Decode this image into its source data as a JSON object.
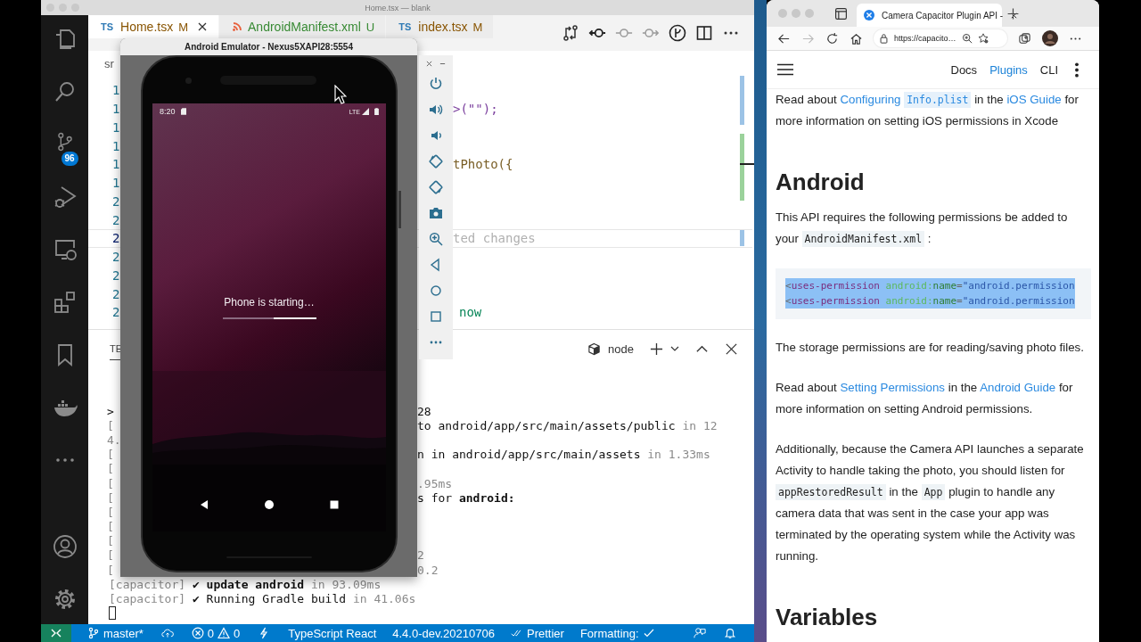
{
  "vscode": {
    "title": "Home.tsx — blank",
    "source_control_badge": "96",
    "tabs": [
      {
        "kind": "ts",
        "badge": "TS",
        "label": "Home.tsx",
        "status": "M",
        "modified": true,
        "selected": true
      },
      {
        "kind": "xml",
        "label": "AndroidManifest.xml",
        "status": "U",
        "modified": false,
        "selected": false
      },
      {
        "kind": "ts",
        "badge": "TS",
        "label": "index.tsx",
        "status": "M",
        "modified": true,
        "selected": false
      }
    ],
    "breadcrumb": "sr",
    "code_lines": [
      {
        "number": "1",
        "current": false
      },
      {
        "number": "1",
        "code": ">(\"\");",
        "kind": "plain",
        "current": false
      },
      {
        "number": "1",
        "current": false
      },
      {
        "number": "1",
        "current": false
      },
      {
        "number": "1",
        "code": "tPhoto({",
        "kind": "call",
        "current": false
      },
      {
        "number": "1",
        "current": false
      },
      {
        "number": "2",
        "current": false
      },
      {
        "number": "2",
        "current": false
      },
      {
        "number": "2",
        "code": "ted changes",
        "kind": "ghost",
        "current": true
      },
      {
        "number": "2",
        "current": false
      },
      {
        "number": "2",
        "current": false
      },
      {
        "number": "2",
        "current": false
      },
      {
        "number": "2",
        "code": "now",
        "kind": "text",
        "current": false
      }
    ],
    "terminal": {
      "tab": "TE",
      "shell": "node",
      "lines": [
        {
          "kind": "split",
          "left": {
            "text": ">",
            "kind": "plain"
          },
          "right": [
            {
              "text": "28",
              "kind": "plain"
            }
          ]
        },
        {
          "kind": "split",
          "left": {
            "text": "[",
            "kind": "dim"
          },
          "right": [
            {
              "text": "to android/app/src/main/assets/public",
              "kind": "plain"
            },
            {
              "text": "in 12",
              "kind": "dim"
            }
          ]
        },
        {
          "kind": "split",
          "left": {
            "text": "4.",
            "kind": "dim"
          }
        },
        {
          "kind": "split",
          "left": {
            "text": "[",
            "kind": "dim"
          },
          "right": [
            {
              "text": "n in android/app/src/main/assets",
              "kind": "plain"
            },
            {
              "text": "in 1.33ms",
              "kind": "dim"
            }
          ]
        },
        {
          "kind": "split",
          "left": {
            "text": "[",
            "kind": "dim"
          }
        },
        {
          "kind": "split",
          "left": {
            "text": "[",
            "kind": "dim"
          },
          "right": [
            {
              "text": ".95ms",
              "kind": "dim"
            }
          ]
        },
        {
          "kind": "split",
          "left": {
            "text": "[",
            "kind": "dim"
          },
          "right": [
            {
              "text": "s for",
              "kind": "plain"
            },
            {
              "text": "android:",
              "kind": "bold"
            }
          ]
        },
        {
          "kind": "split",
          "left": {
            "text": "[",
            "kind": "dim"
          }
        },
        {
          "kind": "split",
          "left": {
            "text": "[",
            "kind": "dim"
          }
        },
        {
          "kind": "split",
          "left": {
            "text": "[",
            "kind": "dim"
          }
        },
        {
          "kind": "split",
          "left": {
            "text": "[",
            "kind": "dim"
          },
          "right": [
            {
              "text": "2",
              "kind": "dim"
            }
          ]
        },
        {
          "kind": "split",
          "left": {
            "text": "[",
            "kind": "dim"
          },
          "right": [
            {
              "text": "0.2",
              "kind": "dim"
            }
          ]
        },
        {
          "kind": "full",
          "right": [
            {
              "text": "[capacitor]",
              "kind": "dim"
            },
            {
              "text": "✔ update android",
              "kind": "bold"
            },
            {
              "text": "in 93.09ms",
              "kind": "dim"
            }
          ]
        },
        {
          "kind": "full",
          "right": [
            {
              "text": "[capacitor]",
              "kind": "dim"
            },
            {
              "text": "✔ Running Gradle build",
              "kind": "plain"
            },
            {
              "text": "in 41.06s",
              "kind": "dim"
            }
          ]
        },
        {
          "kind": "cursor"
        }
      ]
    },
    "status_bar": {
      "branch": "master*",
      "errors": "0",
      "warnings": "0",
      "language": "TypeScript React",
      "version": "4.4.0-dev.20210706",
      "prettier": "Prettier",
      "formatting": "Formatting:"
    }
  },
  "emulator": {
    "title": "Android Emulator - Nexus5XAPI28:5554",
    "time": "8:20",
    "network": "LTE",
    "message": "Phone is starting…"
  },
  "browser": {
    "tab_title": "Camera Capacitor Plugin API -",
    "url": "https://capacito…",
    "nav": [
      {
        "label": "Docs",
        "selected": false
      },
      {
        "label": "Plugins",
        "selected": true
      },
      {
        "label": "CLI",
        "selected": false
      }
    ],
    "content": [
      {
        "kind": "paragraph",
        "parts": [
          {
            "kind": "text",
            "text": "Read about"
          },
          {
            "kind": "link",
            "text": "Configuring"
          },
          {
            "kind": "link-code",
            "text": "Info.plist"
          },
          {
            "kind": "text",
            "text": "in the"
          },
          {
            "kind": "link",
            "text": "iOS Guide"
          },
          {
            "kind": "text",
            "text": "for more information on setting iOS permissions in Xcode"
          }
        ]
      },
      {
        "kind": "heading",
        "text": "Android"
      },
      {
        "kind": "paragraph",
        "parts": [
          {
            "kind": "text",
            "text": "This API requires the following permissions be added to your"
          },
          {
            "kind": "code",
            "text": "AndroidManifest.xml"
          },
          {
            "kind": "text",
            "text": ":"
          }
        ]
      },
      {
        "kind": "codeblock",
        "lines": [
          {
            "selected": true,
            "segments": [
              {
                "kind": "punct",
                "text": "<"
              },
              {
                "kind": "tag",
                "text": "uses-permission"
              },
              {
                "kind": "ns",
                "text": " android:"
              },
              {
                "kind": "attr",
                "text": "name"
              },
              {
                "kind": "punct",
                "text": "="
              },
              {
                "kind": "string",
                "text": "\"android.permission"
              }
            ]
          },
          {
            "selected": true,
            "segments": [
              {
                "kind": "punct",
                "text": "<"
              },
              {
                "kind": "tag",
                "text": "uses-permission"
              },
              {
                "kind": "ns",
                "text": " android:"
              },
              {
                "kind": "attr",
                "text": "name"
              },
              {
                "kind": "punct",
                "text": "="
              },
              {
                "kind": "string",
                "text": "\"android.permission"
              }
            ]
          }
        ]
      },
      {
        "kind": "paragraph",
        "parts": [
          {
            "kind": "text",
            "text": "The storage permissions are for reading/saving photo files."
          }
        ]
      },
      {
        "kind": "paragraph",
        "parts": [
          {
            "kind": "text",
            "text": "Read about"
          },
          {
            "kind": "link",
            "text": "Setting Permissions"
          },
          {
            "kind": "text",
            "text": "in the"
          },
          {
            "kind": "link",
            "text": "Android Guide"
          },
          {
            "kind": "text",
            "text": "for more information on setting Android permissions."
          }
        ]
      },
      {
        "kind": "paragraph",
        "parts": [
          {
            "kind": "text",
            "text": "Additionally, because the Camera API launches a separate Activity to handle taking the photo, you should listen for"
          },
          {
            "kind": "code",
            "text": "appRestoredResult"
          },
          {
            "kind": "text",
            "text": "in the"
          },
          {
            "kind": "code",
            "text": "App"
          },
          {
            "kind": "text",
            "text": "plugin to handle any camera data that was sent in the case your app was terminated by the operating system while the Activity was running."
          }
        ]
      },
      {
        "kind": "heading",
        "text": "Variables"
      }
    ]
  }
}
